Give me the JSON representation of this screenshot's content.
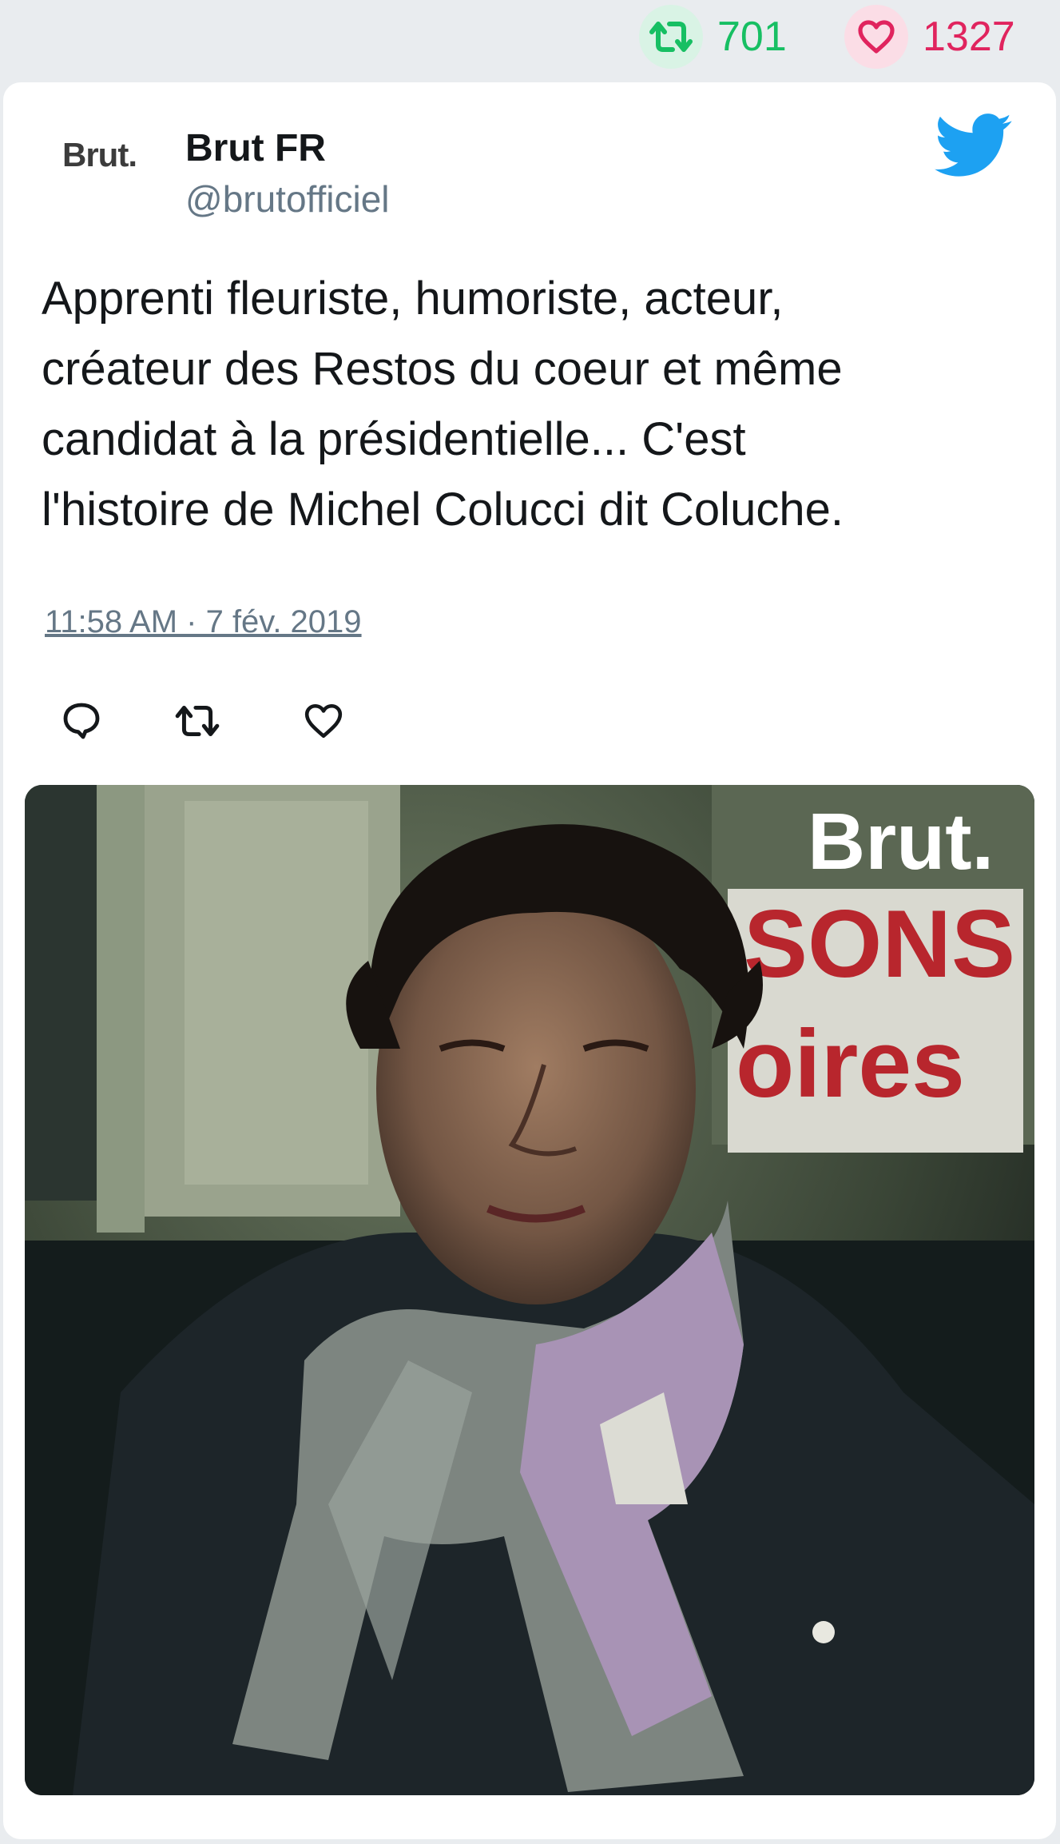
{
  "stats": {
    "retweet_count": "701",
    "like_count": "1327"
  },
  "tweet": {
    "avatar_text": "Brut.",
    "display_name": "Brut FR",
    "handle": "@brutofficiel",
    "text": "Apprenti fleuriste, humoriste, acteur,\ncréateur des Restos du coeur et même\ncandidat à la présidentielle... C'est\nl'histoire de Michel Colucci dit Coluche.",
    "timestamp": "11:58 AM · 7 fév. 2019"
  },
  "media": {
    "watermark": "Brut.",
    "sign_line_1": "SONS",
    "sign_line_2": "oires"
  },
  "icons": {
    "retweet": "retweet-icon",
    "like": "heart-icon",
    "reply": "reply-icon",
    "bird": "twitter-bird-icon"
  },
  "colors": {
    "retweet": "#17bf63",
    "like": "#e0245e",
    "twitter_blue": "#1da1f2",
    "secondary_text": "#657786"
  }
}
